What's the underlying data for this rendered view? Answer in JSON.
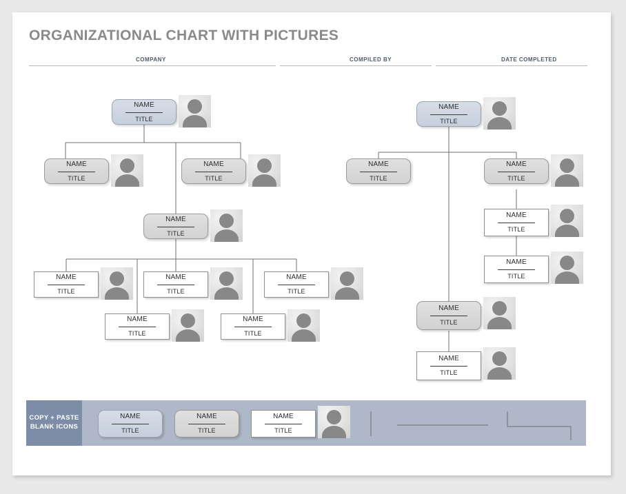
{
  "page": {
    "title": "ORGANIZATIONAL CHART WITH PICTURES"
  },
  "header_fields": [
    {
      "label": "COMPANY",
      "value": ""
    },
    {
      "label": "COMPILED BY",
      "value": ""
    },
    {
      "label": "DATE COMPLETED",
      "value": ""
    }
  ],
  "node_text": {
    "name": "NAME",
    "title": "TITLE"
  },
  "footer": {
    "label_line1": "COPY + PASTE",
    "label_line2": "BLANK ICONS",
    "templates": [
      {
        "style": "blue",
        "name": "NAME",
        "title": "TITLE",
        "has_avatar": false
      },
      {
        "style": "gray",
        "name": "NAME",
        "title": "TITLE",
        "has_avatar": false
      },
      {
        "style": "white",
        "name": "NAME",
        "title": "TITLE",
        "has_avatar": true
      }
    ],
    "connector_samples": [
      {
        "type": "vertical-line"
      },
      {
        "type": "horizontal-line"
      },
      {
        "type": "elbow-bracket"
      }
    ]
  },
  "colors": {
    "page_background": "#ffffff",
    "outer_background": "#e8e8e8",
    "title_text": "#8a8a8a",
    "field_label_text": "#4c5a6e",
    "node_blue_fill": "#ccd4e0",
    "node_gray_fill": "#d8d8d8",
    "node_white_fill": "#ffffff",
    "node_border": "#9a9a9a",
    "avatar_silhouette": "#888888",
    "footer_bar": "#aeb8c8",
    "footer_label_block": "#7d8da8",
    "connector_line": "#6f6f6f"
  },
  "chart_data": {
    "type": "diagram",
    "diagram_kind": "organizational-chart",
    "trees": [
      {
        "id": "left-tree",
        "nodes": [
          {
            "id": "L1",
            "tier": 1,
            "style": "blue",
            "name": "NAME",
            "title": "TITLE",
            "parent": null
          },
          {
            "id": "L2a",
            "tier": 2,
            "style": "gray",
            "name": "NAME",
            "title": "TITLE",
            "parent": "L1"
          },
          {
            "id": "L2b",
            "tier": 2,
            "style": "gray",
            "name": "NAME",
            "title": "TITLE",
            "parent": "L1"
          },
          {
            "id": "L3",
            "tier": 3,
            "style": "gray",
            "name": "NAME",
            "title": "TITLE",
            "parent": "L1"
          },
          {
            "id": "L4a",
            "tier": 4,
            "style": "white",
            "name": "NAME",
            "title": "TITLE",
            "parent": "L3"
          },
          {
            "id": "L4b",
            "tier": 4,
            "style": "white",
            "name": "NAME",
            "title": "TITLE",
            "parent": "L3"
          },
          {
            "id": "L4c",
            "tier": 4,
            "style": "white",
            "name": "NAME",
            "title": "TITLE",
            "parent": "L3"
          },
          {
            "id": "L5a",
            "tier": 5,
            "style": "white",
            "name": "NAME",
            "title": "TITLE",
            "parent": "L3"
          },
          {
            "id": "L5b",
            "tier": 5,
            "style": "white",
            "name": "NAME",
            "title": "TITLE",
            "parent": "L3"
          }
        ]
      },
      {
        "id": "right-tree",
        "nodes": [
          {
            "id": "R1",
            "tier": 1,
            "style": "blue",
            "name": "NAME",
            "title": "TITLE",
            "parent": null
          },
          {
            "id": "R2a",
            "tier": 2,
            "style": "gray",
            "name": "NAME",
            "title": "TITLE",
            "parent": "R1"
          },
          {
            "id": "R2b",
            "tier": 2,
            "style": "gray",
            "name": "NAME",
            "title": "TITLE",
            "parent": "R1"
          },
          {
            "id": "R3",
            "tier": 3,
            "style": "white",
            "name": "NAME",
            "title": "TITLE",
            "parent": "R2b"
          },
          {
            "id": "R4",
            "tier": 4,
            "style": "white",
            "name": "NAME",
            "title": "TITLE",
            "parent": "R3"
          },
          {
            "id": "R5",
            "tier": 5,
            "style": "gray",
            "name": "NAME",
            "title": "TITLE",
            "parent": "R1"
          },
          {
            "id": "R6",
            "tier": 6,
            "style": "white",
            "name": "NAME",
            "title": "TITLE",
            "parent": "R5"
          }
        ]
      }
    ],
    "avatar_count": 16,
    "legend": [],
    "notes": "Blank organizational chart template; every node shows placeholder text NAME / TITLE with an adjacent photo placeholder icon."
  }
}
